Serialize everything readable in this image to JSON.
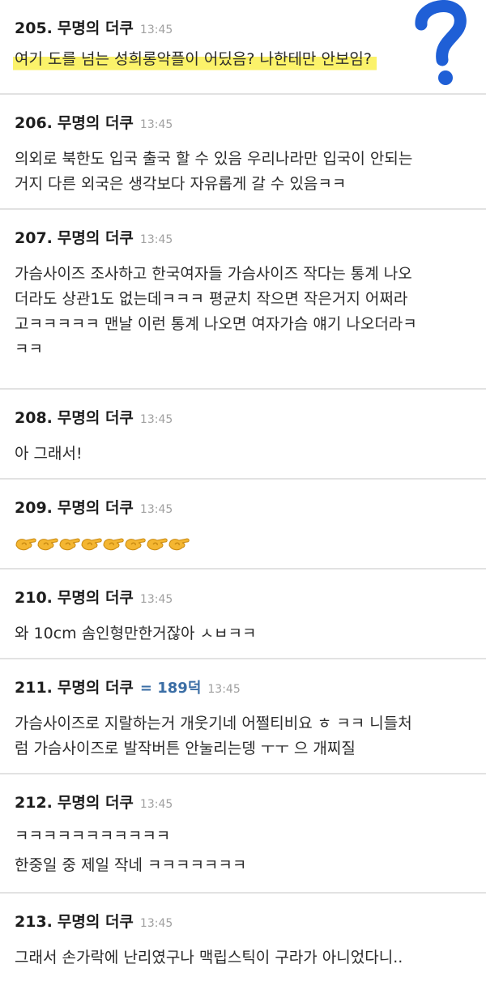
{
  "comments": [
    {
      "number": "205.",
      "nickname": "무명의 더쿠",
      "ref": "",
      "time": "13:45",
      "lines": [
        "여기 도를 넘는 성희롱악플이 어딨음? 나한테만 안보임?"
      ],
      "highlighted": true
    },
    {
      "number": "206.",
      "nickname": "무명의 더쿠",
      "ref": "",
      "time": "13:45",
      "lines": [
        "의외로 북한도 입국 출국 할 수 있음 우리나라만 입국이 안되는",
        "거지 다른 외국은 생각보다 자유롭게 갈 수 있음ㅋㅋ"
      ]
    },
    {
      "number": "207.",
      "nickname": "무명의 더쿠",
      "ref": "",
      "time": "13:45",
      "lines": [
        "가슴사이즈 조사하고 한국여자들 가슴사이즈 작다는 통계 나오",
        "더라도 상관1도 없는데ㅋㅋㅋ 평균치 작으면 작은거지 어쩌라",
        "고ㅋㅋㅋㅋㅋ 맨날 이런 통계 나오면 여자가슴 얘기 나오더라ㅋ",
        "ㅋㅋ"
      ]
    },
    {
      "number": "208.",
      "nickname": "무명의 더쿠",
      "ref": "",
      "time": "13:45",
      "lines": [
        "아 그래서!"
      ]
    },
    {
      "number": "209.",
      "nickname": "무명의 더쿠",
      "ref": "",
      "time": "13:45",
      "lines": [],
      "emoji": "pinching-hand-icon",
      "emoji_count": 8
    },
    {
      "number": "210.",
      "nickname": "무명의 더쿠",
      "ref": "",
      "time": "13:45",
      "lines": [
        "와 10cm 솜인형만한거잖아 ㅅㅂㅋㅋ"
      ]
    },
    {
      "number": "211.",
      "nickname": "무명의 더쿠",
      "ref": "= 189덕",
      "time": "13:45",
      "lines": [
        "가슴사이즈로 지랄하는거 개웃기네 어쩔티비요 ㅎ ㅋㅋ 니들처",
        "럼 가슴사이즈로 발작버튼 안눌리는뎅 ㅜㅜ 으 개찌질"
      ]
    },
    {
      "number": "212.",
      "nickname": "무명의 더쿠",
      "ref": "",
      "time": "13:45",
      "lines": [
        "ㅋㅋㅋㅋㅋㅋㅋㅋㅋㅋㅋ",
        "한중일 중 제일 작네 ㅋㅋㅋㅋㅋㅋㅋ"
      ]
    },
    {
      "number": "213.",
      "nickname": "무명의 더쿠",
      "ref": "",
      "time": "13:45",
      "lines": [
        "그래서 손가락에 난리였구나  맥립스틱이 구라가 아니었다니.."
      ]
    }
  ],
  "colors": {
    "highlight": "#fbf26a",
    "question_mark": "#1f5fd6",
    "ref": "#3b6ea5",
    "divider": "#e2e2e2"
  },
  "annotation_icon": "question-mark-icon"
}
